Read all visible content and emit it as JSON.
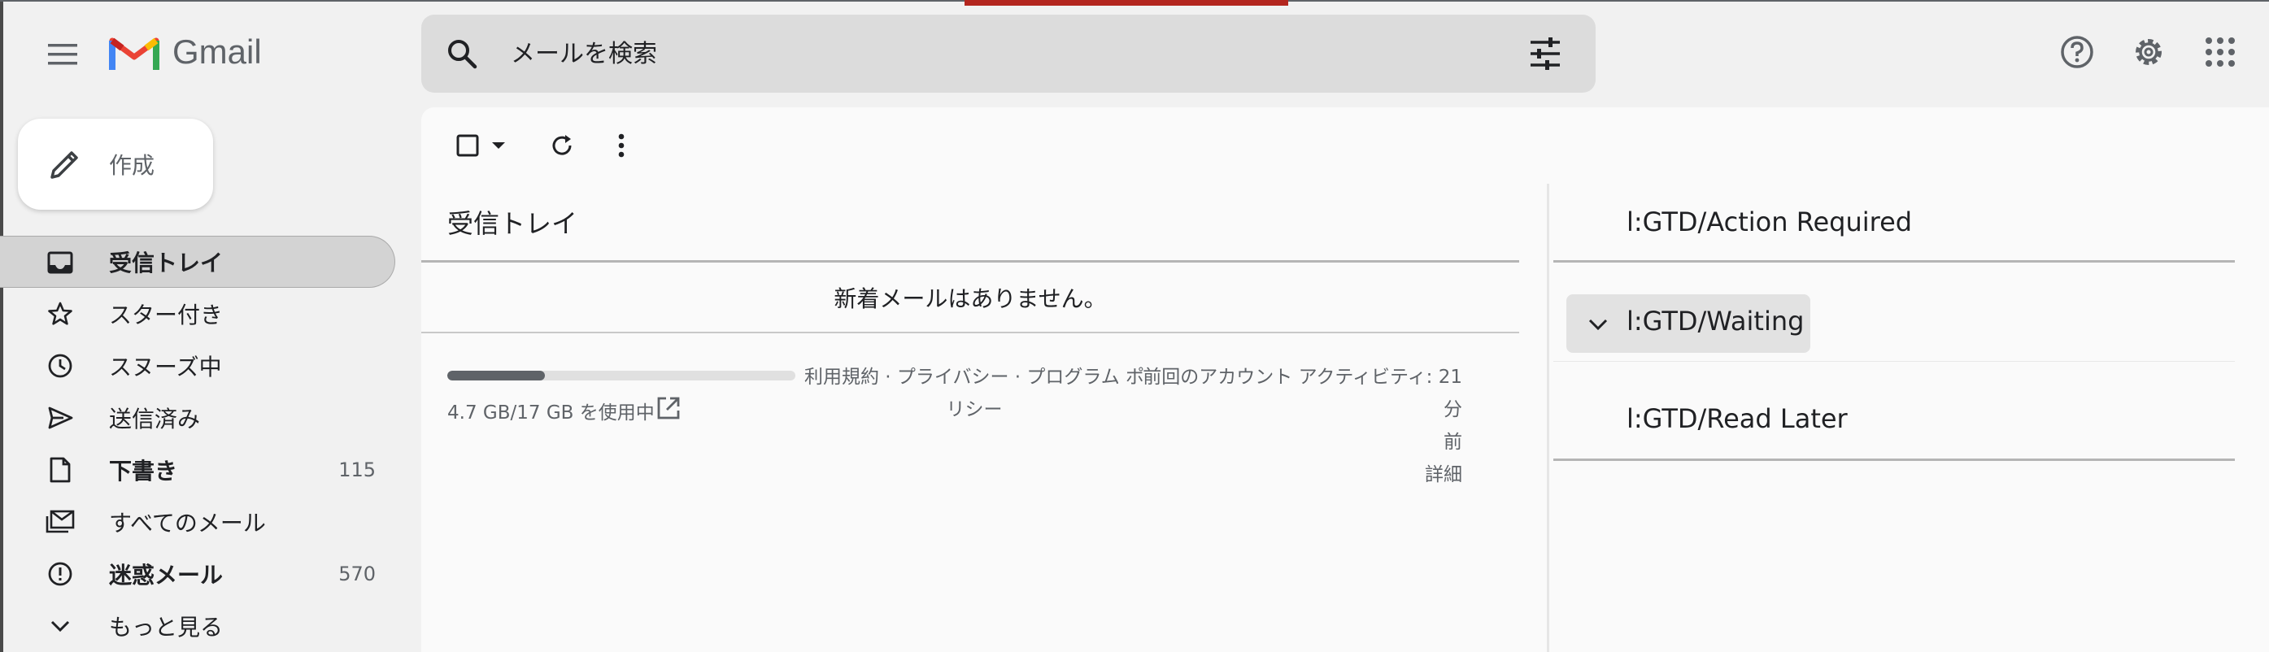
{
  "app": {
    "name": "Gmail"
  },
  "search": {
    "placeholder": "メールを検索"
  },
  "compose": {
    "label": "作成"
  },
  "sidebar": {
    "items": [
      {
        "label": "受信トレイ",
        "count": "",
        "icon": "inbox-icon",
        "active": true,
        "bold": true
      },
      {
        "label": "スター付き",
        "count": "",
        "icon": "star-icon"
      },
      {
        "label": "スヌーズ中",
        "count": "",
        "icon": "clock-icon"
      },
      {
        "label": "送信済み",
        "count": "",
        "icon": "send-icon"
      },
      {
        "label": "下書き",
        "count": "115",
        "icon": "draft-icon",
        "bold": true
      },
      {
        "label": "すべてのメール",
        "count": "",
        "icon": "all-mail-icon"
      },
      {
        "label": "迷惑メール",
        "count": "570",
        "icon": "spam-icon",
        "bold": true
      },
      {
        "label": "もっと見る",
        "count": "",
        "icon": "chevron-down-icon"
      }
    ]
  },
  "inbox": {
    "title": "受信トレイ",
    "empty_message": "新着メールはありません。",
    "storage": {
      "text": "4.7 GB/17 GB を使用中",
      "used_fraction": 0.28
    },
    "footer_links": {
      "line1": "利用規約 · プライバシー · プログラム ポ",
      "line2": "リシー"
    },
    "activity": {
      "line1": "前回のアカウント アクティビティ: 21 分",
      "line2": "前",
      "line3": "詳細"
    }
  },
  "labels": {
    "action_required": "l:GTD/Action Required",
    "waiting": "l:GTD/Waiting",
    "read_later": "l:GTD/Read Later"
  },
  "colors": {
    "brand_red": "#EA4335",
    "active_bg": "#d3d3d3"
  }
}
